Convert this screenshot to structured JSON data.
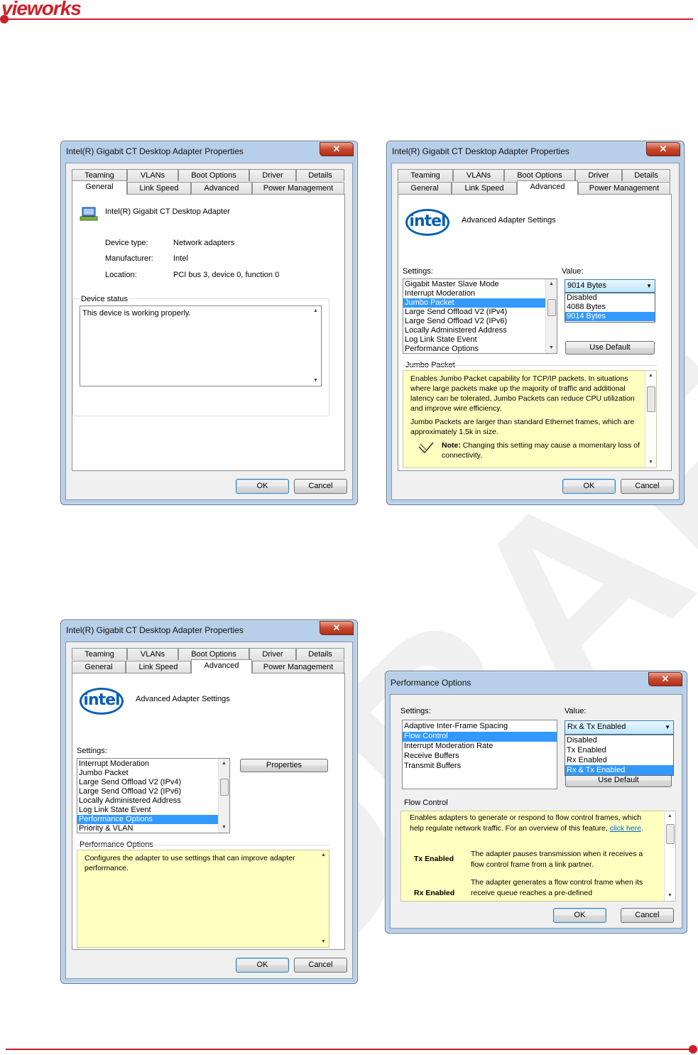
{
  "brand": {
    "logo": "vieworks"
  },
  "watermark": "DRAFT",
  "common": {
    "window_title": "Intel(R) Gigabit CT Desktop Adapter Properties",
    "close_glyph": "✕",
    "tabs_row1": [
      "Teaming",
      "VLANs",
      "Boot Options",
      "Driver",
      "Details"
    ],
    "tabs_row2": [
      "General",
      "Link Speed",
      "Advanced",
      "Power Management"
    ],
    "ok": "OK",
    "cancel": "Cancel",
    "intel_logo": "intel",
    "advanced_heading": "Advanced Adapter Settings",
    "settings_label": "Settings:",
    "value_label": "Value:"
  },
  "general_dialog": {
    "adapter_name": "Intel(R) Gigabit CT Desktop Adapter",
    "device_type_label": "Device type:",
    "device_type_value": "Network adapters",
    "manufacturer_label": "Manufacturer:",
    "manufacturer_value": "Intel",
    "location_label": "Location:",
    "location_value": "PCI bus 3, device 0, function 0",
    "device_status_label": "Device status",
    "device_status_text": "This device is working properly."
  },
  "jumbo_dialog": {
    "settings": [
      "Gigabit Master Slave Mode",
      "Interrupt Moderation",
      "Jumbo Packet",
      "Large Send Offload V2 (IPv4)",
      "Large Send Offload V2 (IPv6)",
      "Locally Administered Address",
      "Log Link State Event",
      "Performance Options"
    ],
    "selected_setting": "Jumbo Packet",
    "value_selected": "9014 Bytes",
    "value_options": [
      "Disabled",
      "4088 Bytes",
      "9014 Bytes"
    ],
    "use_default": "Use Default",
    "help_title": "Jumbo Packet",
    "help_p1": "Enables Jumbo Packet capability for TCP/IP packets. In situations where large packets make up the majority of traffic and additional latency can be tolerated, Jumbo Packets can reduce CPU utilization and improve wire efficiency.",
    "help_p2": "Jumbo Packets are larger than standard Ethernet frames, which are approximately 1.5k in size.",
    "note_label": "Note:",
    "note_text": "Changing this setting may cause a momentary loss of connectivity."
  },
  "perfopt_dialog": {
    "settings": [
      "Interrupt Moderation",
      "Jumbo Packet",
      "Large Send Offload V2 (IPv4)",
      "Large Send Offload V2 (IPv6)",
      "Locally Administered Address",
      "Log Link State Event",
      "Performance Options",
      "Priority & VLAN"
    ],
    "selected_setting": "Performance Options",
    "properties_button": "Properties",
    "help_title": "Performance Options",
    "help_text": "Configures the adapter to use settings that can improve adapter performance."
  },
  "flow_dialog": {
    "title": "Performance Options",
    "settings": [
      "Adaptive Inter-Frame Spacing",
      "Flow Control",
      "Interrupt Moderation Rate",
      "Receive Buffers",
      "Transmit Buffers"
    ],
    "selected_setting": "Flow Control",
    "value_selected": "Rx & Tx Enabled",
    "value_options": [
      "Disabled",
      "Tx Enabled",
      "Rx Enabled",
      "Rx & Tx Enabled"
    ],
    "use_default": "Use Default",
    "help_title": "Flow Control",
    "help_p1_a": "Enables adapters to generate or respond to flow control frames, which help regulate network traffic. For an overview of this feature, ",
    "help_link": "click here",
    "help_p1_b": ".",
    "tx_label": "Tx Enabled",
    "tx_text": "The adapter pauses transmission when it receives a flow control frame from a link partner.",
    "rx_label": "Rx Enabled",
    "rx_text": "The adapter generates a flow control frame when its receive queue reaches a pre-defined"
  }
}
